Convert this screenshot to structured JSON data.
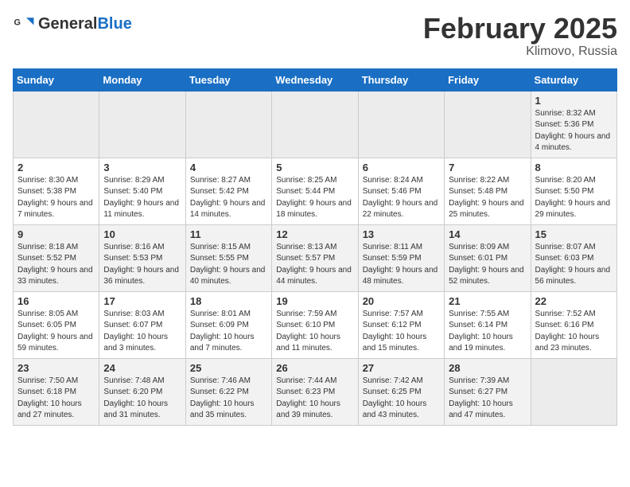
{
  "header": {
    "logo_general": "General",
    "logo_blue": "Blue",
    "month_title": "February 2025",
    "location": "Klimovo, Russia"
  },
  "weekdays": [
    "Sunday",
    "Monday",
    "Tuesday",
    "Wednesday",
    "Thursday",
    "Friday",
    "Saturday"
  ],
  "weeks": [
    [
      {
        "day": "",
        "info": ""
      },
      {
        "day": "",
        "info": ""
      },
      {
        "day": "",
        "info": ""
      },
      {
        "day": "",
        "info": ""
      },
      {
        "day": "",
        "info": ""
      },
      {
        "day": "",
        "info": ""
      },
      {
        "day": "1",
        "info": "Sunrise: 8:32 AM\nSunset: 5:36 PM\nDaylight: 9 hours and 4 minutes."
      }
    ],
    [
      {
        "day": "2",
        "info": "Sunrise: 8:30 AM\nSunset: 5:38 PM\nDaylight: 9 hours and 7 minutes."
      },
      {
        "day": "3",
        "info": "Sunrise: 8:29 AM\nSunset: 5:40 PM\nDaylight: 9 hours and 11 minutes."
      },
      {
        "day": "4",
        "info": "Sunrise: 8:27 AM\nSunset: 5:42 PM\nDaylight: 9 hours and 14 minutes."
      },
      {
        "day": "5",
        "info": "Sunrise: 8:25 AM\nSunset: 5:44 PM\nDaylight: 9 hours and 18 minutes."
      },
      {
        "day": "6",
        "info": "Sunrise: 8:24 AM\nSunset: 5:46 PM\nDaylight: 9 hours and 22 minutes."
      },
      {
        "day": "7",
        "info": "Sunrise: 8:22 AM\nSunset: 5:48 PM\nDaylight: 9 hours and 25 minutes."
      },
      {
        "day": "8",
        "info": "Sunrise: 8:20 AM\nSunset: 5:50 PM\nDaylight: 9 hours and 29 minutes."
      }
    ],
    [
      {
        "day": "9",
        "info": "Sunrise: 8:18 AM\nSunset: 5:52 PM\nDaylight: 9 hours and 33 minutes."
      },
      {
        "day": "10",
        "info": "Sunrise: 8:16 AM\nSunset: 5:53 PM\nDaylight: 9 hours and 36 minutes."
      },
      {
        "day": "11",
        "info": "Sunrise: 8:15 AM\nSunset: 5:55 PM\nDaylight: 9 hours and 40 minutes."
      },
      {
        "day": "12",
        "info": "Sunrise: 8:13 AM\nSunset: 5:57 PM\nDaylight: 9 hours and 44 minutes."
      },
      {
        "day": "13",
        "info": "Sunrise: 8:11 AM\nSunset: 5:59 PM\nDaylight: 9 hours and 48 minutes."
      },
      {
        "day": "14",
        "info": "Sunrise: 8:09 AM\nSunset: 6:01 PM\nDaylight: 9 hours and 52 minutes."
      },
      {
        "day": "15",
        "info": "Sunrise: 8:07 AM\nSunset: 6:03 PM\nDaylight: 9 hours and 56 minutes."
      }
    ],
    [
      {
        "day": "16",
        "info": "Sunrise: 8:05 AM\nSunset: 6:05 PM\nDaylight: 9 hours and 59 minutes."
      },
      {
        "day": "17",
        "info": "Sunrise: 8:03 AM\nSunset: 6:07 PM\nDaylight: 10 hours and 3 minutes."
      },
      {
        "day": "18",
        "info": "Sunrise: 8:01 AM\nSunset: 6:09 PM\nDaylight: 10 hours and 7 minutes."
      },
      {
        "day": "19",
        "info": "Sunrise: 7:59 AM\nSunset: 6:10 PM\nDaylight: 10 hours and 11 minutes."
      },
      {
        "day": "20",
        "info": "Sunrise: 7:57 AM\nSunset: 6:12 PM\nDaylight: 10 hours and 15 minutes."
      },
      {
        "day": "21",
        "info": "Sunrise: 7:55 AM\nSunset: 6:14 PM\nDaylight: 10 hours and 19 minutes."
      },
      {
        "day": "22",
        "info": "Sunrise: 7:52 AM\nSunset: 6:16 PM\nDaylight: 10 hours and 23 minutes."
      }
    ],
    [
      {
        "day": "23",
        "info": "Sunrise: 7:50 AM\nSunset: 6:18 PM\nDaylight: 10 hours and 27 minutes."
      },
      {
        "day": "24",
        "info": "Sunrise: 7:48 AM\nSunset: 6:20 PM\nDaylight: 10 hours and 31 minutes."
      },
      {
        "day": "25",
        "info": "Sunrise: 7:46 AM\nSunset: 6:22 PM\nDaylight: 10 hours and 35 minutes."
      },
      {
        "day": "26",
        "info": "Sunrise: 7:44 AM\nSunset: 6:23 PM\nDaylight: 10 hours and 39 minutes."
      },
      {
        "day": "27",
        "info": "Sunrise: 7:42 AM\nSunset: 6:25 PM\nDaylight: 10 hours and 43 minutes."
      },
      {
        "day": "28",
        "info": "Sunrise: 7:39 AM\nSunset: 6:27 PM\nDaylight: 10 hours and 47 minutes."
      },
      {
        "day": "",
        "info": ""
      }
    ]
  ]
}
